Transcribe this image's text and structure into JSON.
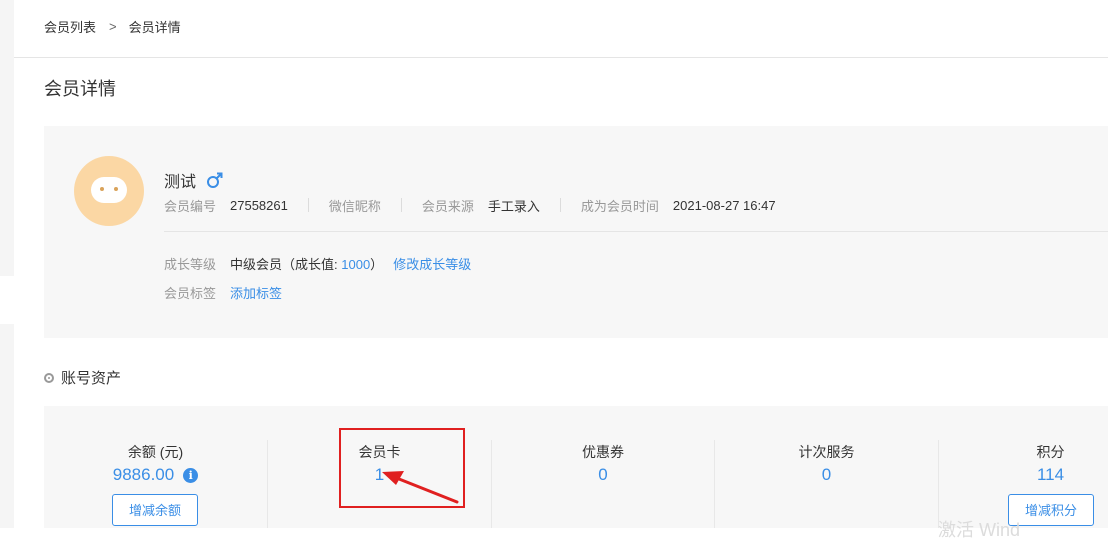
{
  "breadcrumb": {
    "parent": "会员列表",
    "separator": ">",
    "current": "会员详情"
  },
  "page_title": "会员详情",
  "profile": {
    "name": "测试",
    "gender_icon": "male-icon",
    "member_no_label": "会员编号",
    "member_no": "27558261",
    "wechat_nick_label": "微信昵称",
    "source_label": "会员来源",
    "source": "手工录入",
    "join_time_label": "成为会员时间",
    "join_time": "2021-08-27 16:47",
    "growth_label": "成长等级",
    "growth_prefix": "中级会员（成长值: ",
    "growth_value": "1000",
    "growth_suffix": "）",
    "modify_growth_link": "修改成长等级",
    "tags_label": "会员标签",
    "add_tag_link": "添加标签"
  },
  "assets": {
    "section_title": "账号资产",
    "balance_label": "余额 (元)",
    "balance_value": "9886.00",
    "balance_button": "增减余额",
    "card_label": "会员卡",
    "card_value": "1",
    "coupon_label": "优惠券",
    "coupon_value": "0",
    "service_label": "计次服务",
    "service_value": "0",
    "points_label": "积分",
    "points_value": "114",
    "points_button": "增减积分"
  },
  "watermark": "激活 Wind",
  "colors": {
    "accent": "#3a8ee6",
    "highlight": "#e02020",
    "card_bg": "#f7f7f7"
  }
}
